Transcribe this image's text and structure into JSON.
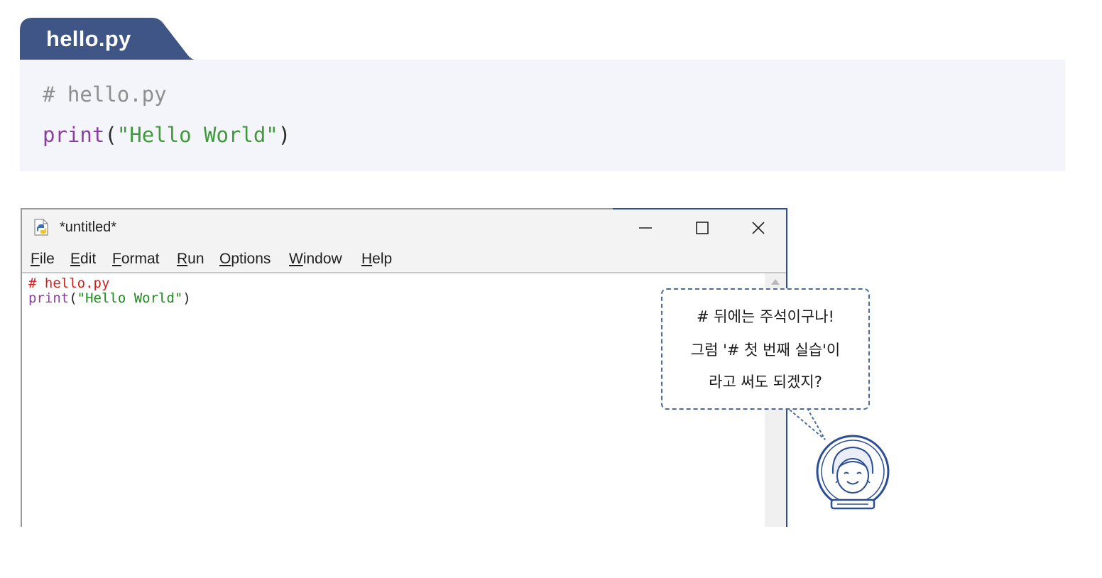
{
  "listing": {
    "tab_label": "hello.py",
    "line1": "# hello.py",
    "line2": {
      "keyword": "print",
      "open": "(",
      "string": "\"Hello World\"",
      "close": ")"
    },
    "colors": {
      "tab": "#3e5586",
      "background": "#f4f5fa",
      "comment": "#8f8f8f",
      "keyword": "#8a3f9e",
      "string": "#3f9a3a"
    }
  },
  "window": {
    "title": "*untitled*",
    "icon": "python-idle-icon",
    "controls": [
      "minimize-icon",
      "maximize-icon",
      "close-icon"
    ],
    "menu": [
      "File",
      "Edit",
      "Format",
      "Run",
      "Options",
      "Window",
      "Help"
    ],
    "editor": {
      "line1": "# hello.py",
      "line2": {
        "keyword": "print",
        "open": "(",
        "string": "\"Hello World\"",
        "close": ")"
      }
    },
    "colors": {
      "accent": "#2c4e96",
      "comment": "#d22020",
      "keyword": "#8a3f9e",
      "string": "#1e8a1e"
    }
  },
  "bubble": {
    "line1": "# 뒤에는 주석이구나!",
    "line2": "그럼 '# 첫 번째 실습'이",
    "line3": "라고 써도 되겠지?",
    "border_color": "#4a6b9c"
  },
  "character": {
    "icon": "astronaut-character-icon"
  }
}
